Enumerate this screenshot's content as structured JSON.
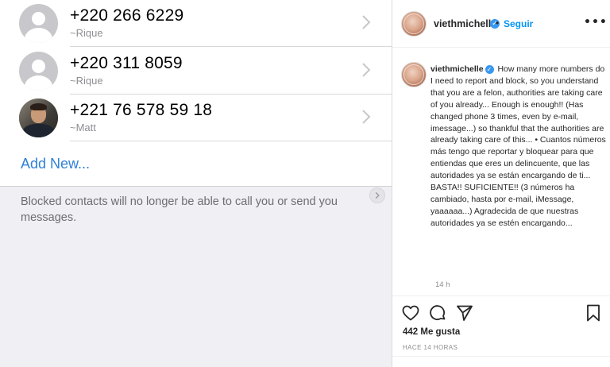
{
  "blocked_list": {
    "contacts": [
      {
        "number": "+220 266 6229",
        "name": "~Rique",
        "avatar": "default-person-icon"
      },
      {
        "number": "+220 311 8059",
        "name": "~Rique",
        "avatar": "default-person-icon"
      },
      {
        "number": "+221 76 578 59 18",
        "name": "~Matt",
        "avatar": "contact-photo"
      }
    ],
    "add_new_label": "Add New...",
    "footer_note": "Blocked contacts will no longer be able to call you or send you messages.",
    "accent_color": "#2f80d8"
  },
  "instagram": {
    "header": {
      "username": "viethmichelle",
      "follow_label": "Seguir",
      "separator": "•"
    },
    "caption": {
      "username": "viethmichelle",
      "text": "How many more numbers do I need to report and block, so you understand that you are a felon, authorities are taking care of you already... Enough is enough!! (Has changed phone 3 times, even by e-mail, imessage...) so thankful that the authorities are already taking care of this... • Cuantos números más tengo que reportar y bloquear para que entiendas que eres un delincuente, que las autoridades ya se están encargando de ti... BASTA!! SUFICIENTE!! (3 números ha cambiado, hasta por e-mail, iMessage, yaaaaaa...) Agradecida de que nuestras autoridades ya se estén encargando..."
    },
    "comment_time": "14 h",
    "likes": "442 Me gusta",
    "posted_time": "HACE 14 HORAS",
    "icons": {
      "like": "heart-icon",
      "comment": "comment-bubble-icon",
      "share": "paper-plane-icon",
      "save": "bookmark-icon",
      "more": "more-options-icon"
    },
    "colors": {
      "link_blue": "#0095f6",
      "verified_blue": "#3897f0"
    }
  }
}
